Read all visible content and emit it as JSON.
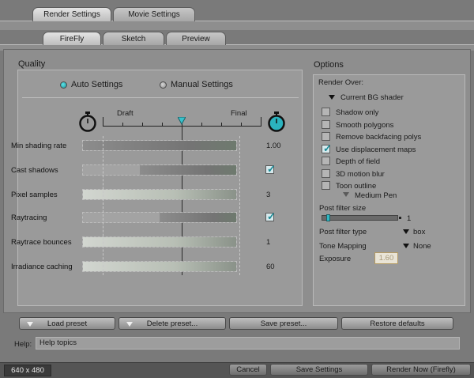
{
  "tabs": [
    {
      "label": "Render Settings",
      "active": true
    },
    {
      "label": "Movie Settings",
      "active": false
    }
  ],
  "subtabs": [
    {
      "label": "FireFly",
      "active": true
    },
    {
      "label": "Sketch",
      "active": false
    },
    {
      "label": "Preview",
      "active": false
    }
  ],
  "quality": {
    "title": "Quality",
    "auto_label": "Auto Settings",
    "manual_label": "Manual Settings",
    "selected": "auto",
    "draft_label": "Draft",
    "final_label": "Final",
    "slider_position": 0.5,
    "rows": [
      {
        "label": "Min shading rate",
        "value": "1.00",
        "fill": 1.0,
        "tone": "dark"
      },
      {
        "label": "Cast shadows",
        "value": "",
        "checkbox": true,
        "fill": 0.63,
        "tone": "dark"
      },
      {
        "label": "Pixel samples",
        "value": "3",
        "fill": 1.0,
        "tone": "light"
      },
      {
        "label": "Raytracing",
        "value": "",
        "checkbox": true,
        "fill": 0.5,
        "tone": "dark"
      },
      {
        "label": "Raytrace bounces",
        "value": "1",
        "fill": 1.0,
        "tone": "light"
      },
      {
        "label": "Irradiance caching",
        "value": "60",
        "fill": 1.0,
        "tone": "light"
      }
    ]
  },
  "options": {
    "title": "Options",
    "render_over_label": "Render Over:",
    "render_over_value": "Current BG shader",
    "checkboxes": [
      {
        "label": "Shadow only",
        "checked": false
      },
      {
        "label": "Smooth polygons",
        "checked": false
      },
      {
        "label": "Remove backfacing polys",
        "checked": false
      },
      {
        "label": "Use displacement maps",
        "checked": true
      },
      {
        "label": "Depth of field",
        "checked": false
      },
      {
        "label": "3D motion blur",
        "checked": false
      },
      {
        "label": "Toon outline",
        "checked": false
      }
    ],
    "toon_outline_style": "Medium Pen",
    "post_filter_size_label": "Post filter size",
    "post_filter_size_value": "1",
    "post_filter_size_level": 0.05,
    "post_filter_type_label": "Post filter type",
    "post_filter_type_value": "box",
    "tone_mapping_label": "Tone Mapping",
    "tone_mapping_value": "None",
    "exposure_label": "Exposure",
    "exposure_value": "1.60"
  },
  "buttons": {
    "load_preset": "Load preset",
    "delete_preset": "Delete preset...",
    "save_preset": "Save preset...",
    "restore_defaults": "Restore defaults"
  },
  "help": {
    "label": "Help:",
    "text": "Help topics"
  },
  "status": {
    "resolution": "640 x 480",
    "cancel": "Cancel",
    "save_settings": "Save Settings",
    "render_now": "Render Now (Firefly)"
  }
}
